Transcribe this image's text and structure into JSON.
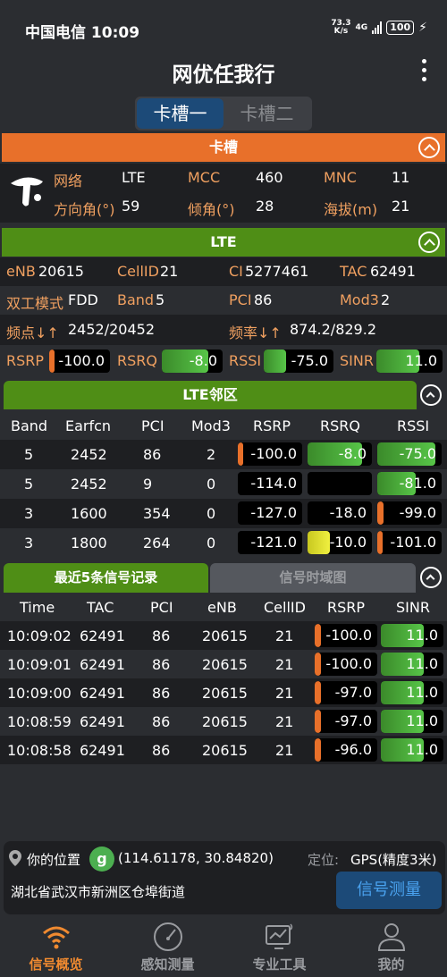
{
  "status": {
    "carrier_time": "中国电信 10:09",
    "speed": "73.3",
    "speed_unit": "K/s",
    "net": "4G",
    "battery": "100"
  },
  "app": {
    "title": "网优任我行"
  },
  "sim_tabs": [
    "卡槽一",
    "卡槽二"
  ],
  "card": {
    "title": "卡槽",
    "net_label": "网络",
    "net": "LTE",
    "mcc_label": "MCC",
    "mcc": "460",
    "mnc_label": "MNC",
    "mnc": "11",
    "azimuth_label": "方向角(°)",
    "azimuth": "59",
    "tilt_label": "倾角(°)",
    "tilt": "28",
    "alt_label": "海拔(m)",
    "alt": "21"
  },
  "lte": {
    "title": "LTE",
    "enb_label": "eNB",
    "enb": "20615",
    "cellid_label": "CellID",
    "cellid": "21",
    "ci_label": "CI",
    "ci": "5277461",
    "tac_label": "TAC",
    "tac": "62491",
    "duplex_label": "双工模式",
    "duplex": "FDD",
    "band_label": "Band",
    "band": "5",
    "pci_label": "PCI",
    "pci": "86",
    "mod3_label": "Mod3",
    "mod3": "2",
    "earfcn_label": "频点↓↑",
    "earfcn": "2452/20452",
    "freq_label": "频率↓↑",
    "freq": "874.2/829.2",
    "rsrp_label": "RSRP",
    "rsrp": "-100.0",
    "rsrq_label": "RSRQ",
    "rsrq": "-8.0",
    "rssi_label": "RSSI",
    "rssi": "-75.0",
    "sinr_label": "SINR",
    "sinr": "11.0"
  },
  "neighbors": {
    "title": "LTE邻区",
    "headers": [
      "Band",
      "Earfcn",
      "PCI",
      "Mod3",
      "RSRP",
      "RSRQ",
      "RSSI"
    ],
    "rows": [
      {
        "band": "5",
        "earfcn": "2452",
        "pci": "86",
        "mod3": "2",
        "rsrp": "-100.0",
        "rsrq": "-8.0",
        "rssi": "-75.0",
        "rsrp_lvl": 0.05,
        "rsrq_lvl": 0.85,
        "rssi_lvl": 0.9
      },
      {
        "band": "5",
        "earfcn": "2452",
        "pci": "9",
        "mod3": "0",
        "rsrp": "-114.0",
        "rsrq": "",
        "rssi": "-81.0",
        "rsrp_lvl": 0,
        "rsrq_lvl": 0,
        "rssi_lvl": 0.6
      },
      {
        "band": "3",
        "earfcn": "1600",
        "pci": "354",
        "mod3": "0",
        "rsrp": "-127.0",
        "rsrq": "-18.0",
        "rssi": "-99.0",
        "rsrp_lvl": 0,
        "rsrq_lvl": 0,
        "rssi_lvl": 0.1
      },
      {
        "band": "3",
        "earfcn": "1800",
        "pci": "264",
        "mod3": "0",
        "rsrp": "-121.0",
        "rsrq": "-10.0",
        "rssi": "-101.0",
        "rsrp_lvl": 0,
        "rsrq_lvl": 0.35,
        "rssi_lvl": 0.08
      }
    ]
  },
  "records": {
    "tab_active": "最近5条信号记录",
    "tab_inactive": "信号时域图",
    "headers": [
      "Time",
      "TAC",
      "PCI",
      "eNB",
      "CellID",
      "RSRP",
      "SINR"
    ],
    "rows": [
      {
        "time": "10:09:02",
        "tac": "62491",
        "pci": "86",
        "enb": "20615",
        "cellid": "21",
        "rsrp": "-100.0",
        "sinr": "11.0"
      },
      {
        "time": "10:09:01",
        "tac": "62491",
        "pci": "86",
        "enb": "20615",
        "cellid": "21",
        "rsrp": "-100.0",
        "sinr": "11.0"
      },
      {
        "time": "10:09:00",
        "tac": "62491",
        "pci": "86",
        "enb": "20615",
        "cellid": "21",
        "rsrp": "-97.0",
        "sinr": "11.0"
      },
      {
        "time": "10:08:59",
        "tac": "62491",
        "pci": "86",
        "enb": "20615",
        "cellid": "21",
        "rsrp": "-97.0",
        "sinr": "11.0"
      },
      {
        "time": "10:08:58",
        "tac": "62491",
        "pci": "86",
        "enb": "20615",
        "cellid": "21",
        "rsrp": "-96.0",
        "sinr": "11.0"
      }
    ]
  },
  "location": {
    "label": "你的位置",
    "coords": "(114.61178, 30.84820)",
    "mode_label": "定位:",
    "mode": "GPS(精度3米)",
    "address": "湖北省武汉市新洲区仓埠街道",
    "measure_button": "信号测量"
  },
  "nav": [
    {
      "label": "信号概览",
      "icon": "wifi-icon"
    },
    {
      "label": "感知测量",
      "icon": "gauge-icon"
    },
    {
      "label": "专业工具",
      "icon": "monitor-icon"
    },
    {
      "label": "我的",
      "icon": "person-icon"
    }
  ],
  "colors": {
    "orange": "#e8702a",
    "green": "#4f8e16",
    "accent": "#f08a30",
    "blue": "#1c4a78"
  }
}
